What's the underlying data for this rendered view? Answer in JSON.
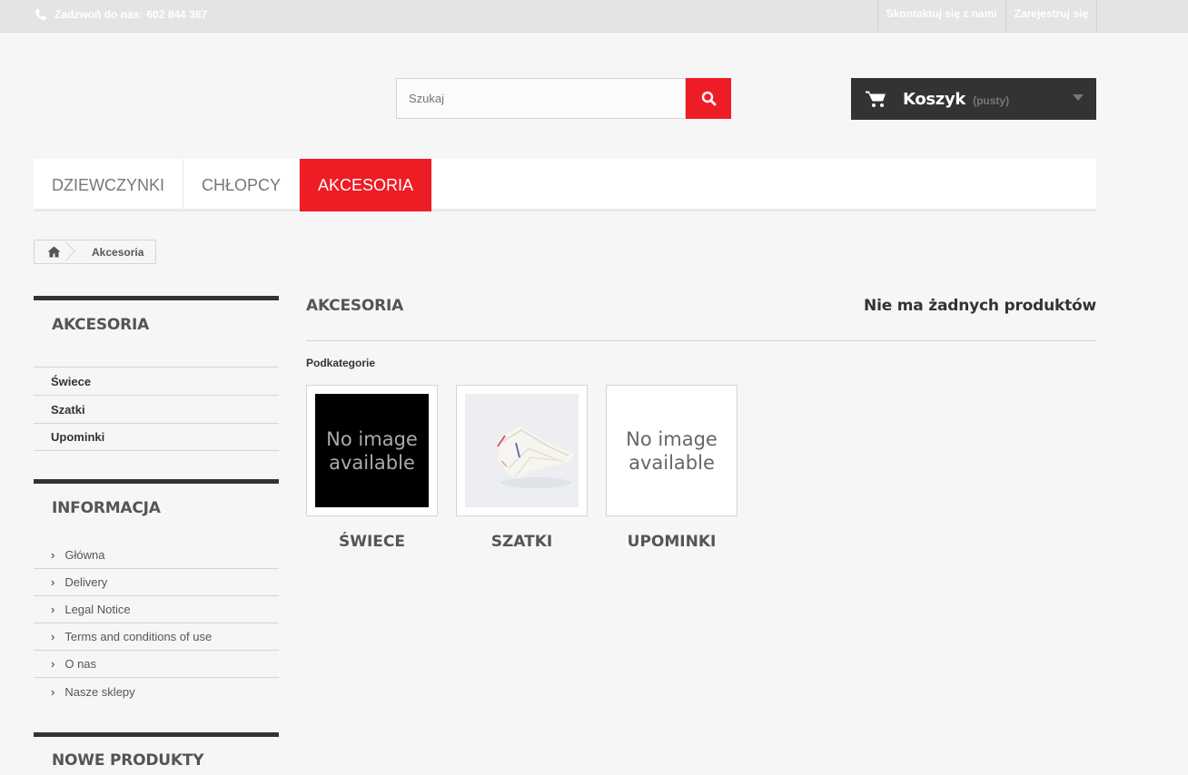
{
  "topbar": {
    "phone_label": "Zadzwoń do nas:",
    "phone_number": "602 844 387",
    "links": [
      "Skontaktuj się z nami",
      "Zarejestruj się"
    ]
  },
  "search": {
    "placeholder": "Szukaj"
  },
  "cart": {
    "title": "Koszyk",
    "state": "(pusty)"
  },
  "menu": {
    "items": [
      "DZIEWCZYNKI",
      "CHŁOPCY",
      "AKCESORIA"
    ],
    "active": "AKCESORIA"
  },
  "breadcrumb": {
    "current": "Akcesoria"
  },
  "sidebar": {
    "categories_title": "AKCESORIA",
    "categories": [
      "Świece",
      "Szatki",
      "Upominki"
    ],
    "info_title": "INFORMACJA",
    "info_links": [
      "Główna",
      "Delivery",
      "Legal Notice",
      "Terms and conditions of use",
      "O nas",
      "Nasze sklepy"
    ],
    "new_title": "NOWE PRODUKTY"
  },
  "content": {
    "title": "AKCESORIA",
    "count_text": "Nie ma żadnych produktów",
    "subcategories_heading": "Podkategorie",
    "subcategories": [
      {
        "name": "ŚWIECE",
        "image_text": "No image available",
        "image_style": "black"
      },
      {
        "name": "SZATKI",
        "image_text": "",
        "image_style": "photo"
      },
      {
        "name": "UPOMINKI",
        "image_text": "No image available",
        "image_style": "white"
      }
    ]
  },
  "colors": {
    "accent": "#ee1c25",
    "dark": "#333333",
    "background": "#f6f6f6"
  }
}
